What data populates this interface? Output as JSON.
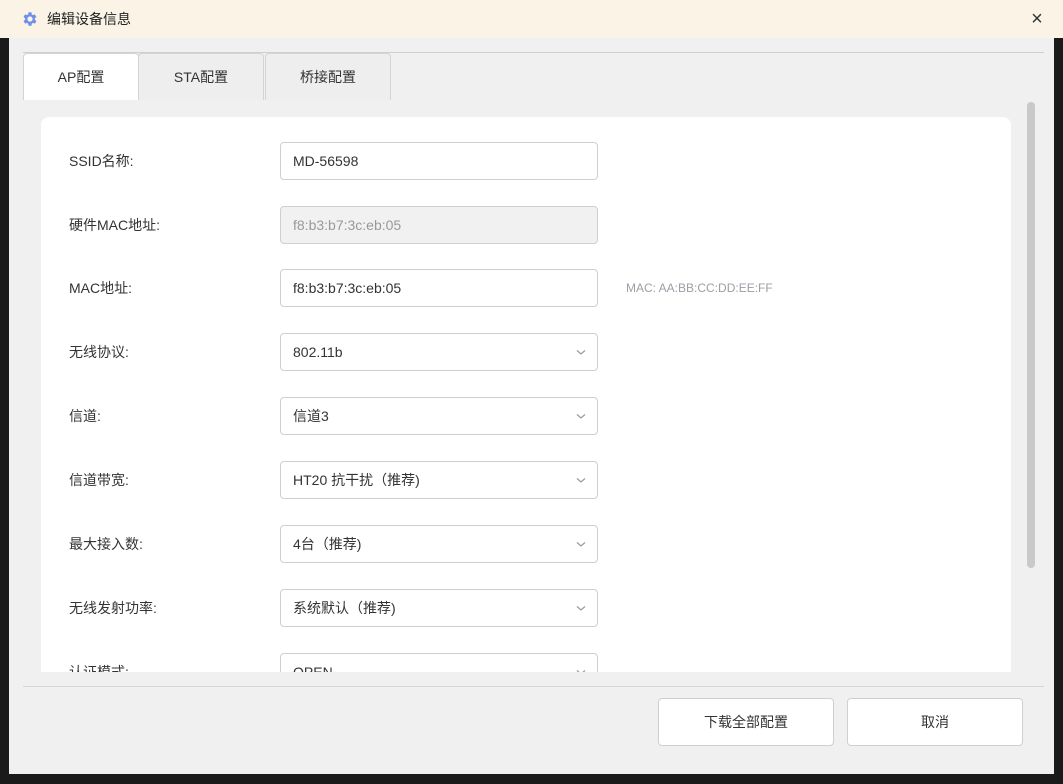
{
  "window": {
    "title": "编辑设备信息",
    "title_icon": "gear-icon",
    "close_label": "×"
  },
  "tabs": [
    {
      "label": "AP配置",
      "active": true
    },
    {
      "label": "STA配置",
      "active": false
    },
    {
      "label": "桥接配置",
      "active": false
    }
  ],
  "form": {
    "ssid": {
      "label": "SSID名称:",
      "value": "MD-56598"
    },
    "hw_mac": {
      "label": "硬件MAC地址:",
      "value": "f8:b3:b7:3c:eb:05"
    },
    "mac": {
      "label": "MAC地址:",
      "value": "f8:b3:b7:3c:eb:05",
      "hint": "MAC: AA:BB:CC:DD:EE:FF"
    },
    "protocol": {
      "label": "无线协议:",
      "value": "802.11b"
    },
    "channel": {
      "label": "信道:",
      "value": "信道3"
    },
    "bandwidth": {
      "label": "信道带宽:",
      "value": "HT20 抗干扰（推荐)"
    },
    "max_clients": {
      "label": "最大接入数:",
      "value": "4台（推荐)"
    },
    "tx_power": {
      "label": "无线发射功率:",
      "value": "系统默认（推荐)"
    },
    "auth_mode": {
      "label": "认证模式:",
      "value": "OPEN"
    }
  },
  "footer": {
    "download_label": "下载全部配置",
    "cancel_label": "取消"
  },
  "colors": {
    "titlebar_bg": "#faf3e6",
    "icon_accent": "#6f8fe8"
  }
}
